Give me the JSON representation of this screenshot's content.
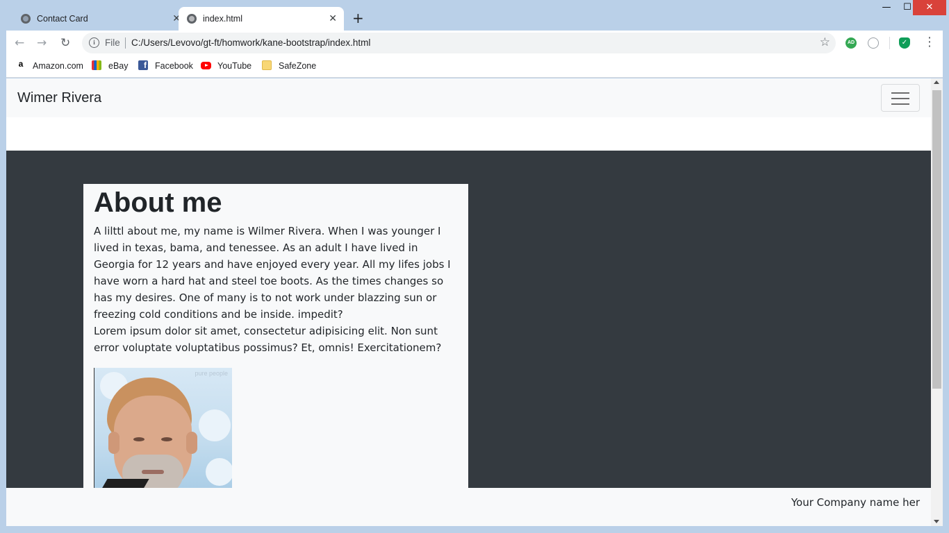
{
  "browser": {
    "tabs": [
      {
        "title": "Contact Card",
        "icon": "globe-icon",
        "active": false
      },
      {
        "title": "index.html",
        "icon": "globe-icon",
        "active": true
      }
    ],
    "new_tab_glyph": "+",
    "tab_close_glyph": "✕",
    "window_controls": {
      "minimize": "—",
      "maximize": "☐",
      "close": "✕"
    },
    "nav": {
      "back": "←",
      "forward": "→",
      "reload": "↻"
    },
    "address": {
      "info_glyph": "i",
      "scheme_label": "File",
      "url": "C:/Users/Levovo/gt-ft/homwork/kane-bootstrap/index.html",
      "star": "☆"
    },
    "extensions": [
      {
        "name": "adguard-icon",
        "label": "AD"
      },
      {
        "name": "extension-icon",
        "label": ""
      },
      {
        "name": "shield-check-icon",
        "label": "✓"
      }
    ],
    "menu_glyph": "⋮",
    "bookmarks": [
      {
        "label": "Amazon.com",
        "icon": "amazon-icon",
        "glyph": "a"
      },
      {
        "label": "eBay",
        "icon": "ebay-icon",
        "glyph": ""
      },
      {
        "label": "Facebook",
        "icon": "facebook-icon",
        "glyph": "f"
      },
      {
        "label": "YouTube",
        "icon": "youtube-icon",
        "glyph": ""
      },
      {
        "label": "SafeZone",
        "icon": "folder-icon",
        "glyph": ""
      }
    ]
  },
  "page": {
    "brand": "Wimer Rivera",
    "about": {
      "heading": "About me",
      "paragraph": "A lilttl about me, my name is Wilmer Rivera. When I was younger I lived in texas, bama, and tenessee. As an adult I have lived in Georgia for 12 years and have enjoyed every year. All my lifes jobs I have worn a hard hat and steel toe boots. As the times changes so has my desires. One of many is to not work under blazzing sun or freezing cold conditions and be inside. impedit?",
      "lorem": "Lorem ipsum dolor sit amet, consectetur adipisicing elit. Non sunt error voluptate voluptatibus possimus? Et, omnis! Exercitationem?",
      "photo_watermark": "pure people"
    },
    "footer": "Your Company name her"
  },
  "colors": {
    "frame": "#bad0e8",
    "navbar_bg": "#f8f9fa",
    "dark_section": "#343a40",
    "close_button": "#d9423a"
  }
}
